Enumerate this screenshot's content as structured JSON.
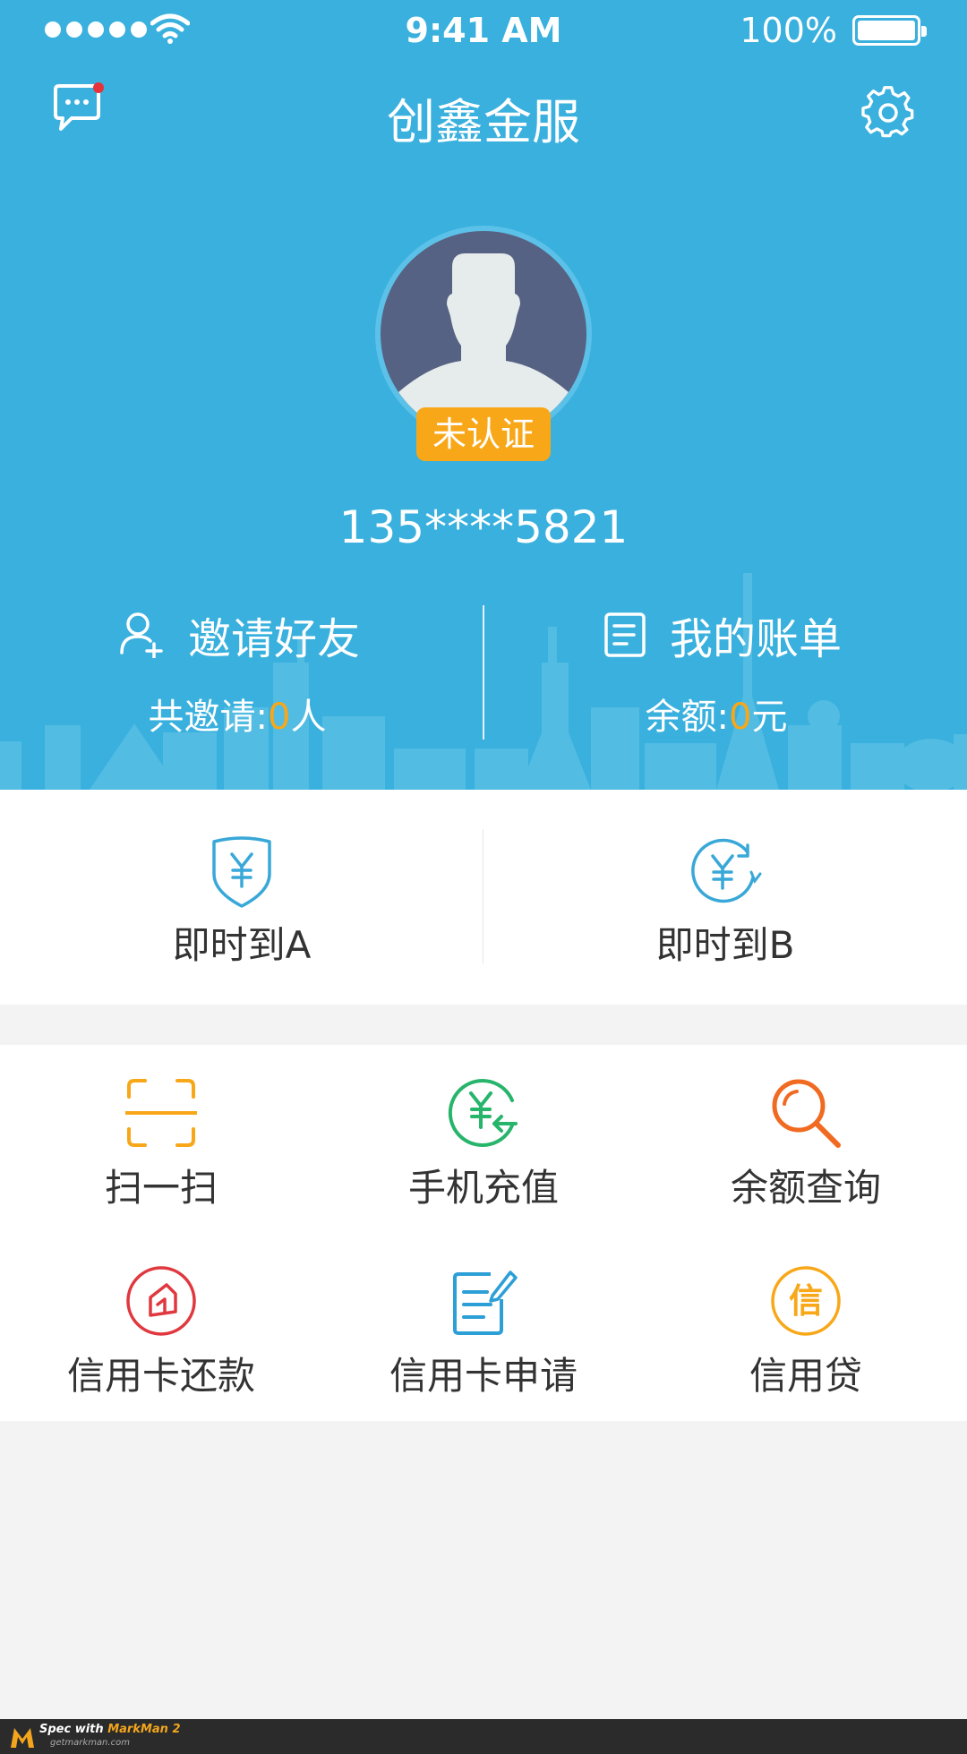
{
  "status_bar": {
    "time": "9:41 AM",
    "battery": "100%"
  },
  "header": {
    "title": "创鑫金服"
  },
  "profile": {
    "badge": "未认证",
    "phone": "135****5821"
  },
  "actions": {
    "invite_label": "邀请好友",
    "bill_label": "我的账单",
    "invite_count_prefix": "共邀请:",
    "invite_count": "0",
    "invite_count_suffix": "人",
    "balance_prefix": "余额:",
    "balance": "0",
    "balance_suffix": "元"
  },
  "transfer": [
    {
      "label": "即时到A",
      "icon": "shield-yen-icon"
    },
    {
      "label": "即时到B",
      "icon": "yen-refresh-icon"
    }
  ],
  "services": [
    {
      "label": "扫一扫",
      "icon": "scan-icon",
      "color": "#f8a718"
    },
    {
      "label": "手机充值",
      "icon": "recharge-icon",
      "color": "#27b46b"
    },
    {
      "label": "余额查询",
      "icon": "search-icon",
      "color": "#f16a21"
    },
    {
      "label": "信用卡还款",
      "icon": "card-repay-icon",
      "color": "#e0383e"
    },
    {
      "label": "信用卡申请",
      "icon": "card-apply-icon",
      "color": "#2d9fd7"
    },
    {
      "label": "信用贷",
      "icon": "credit-loan-icon",
      "color": "#f8a718",
      "icon_text": "信"
    }
  ],
  "footer": {
    "brand_prefix": "Spec with",
    "brand_name": "MarkMan 2",
    "site": "getmarkman.com"
  },
  "colors": {
    "primary": "#39b0dd",
    "accent": "#f8a718"
  }
}
